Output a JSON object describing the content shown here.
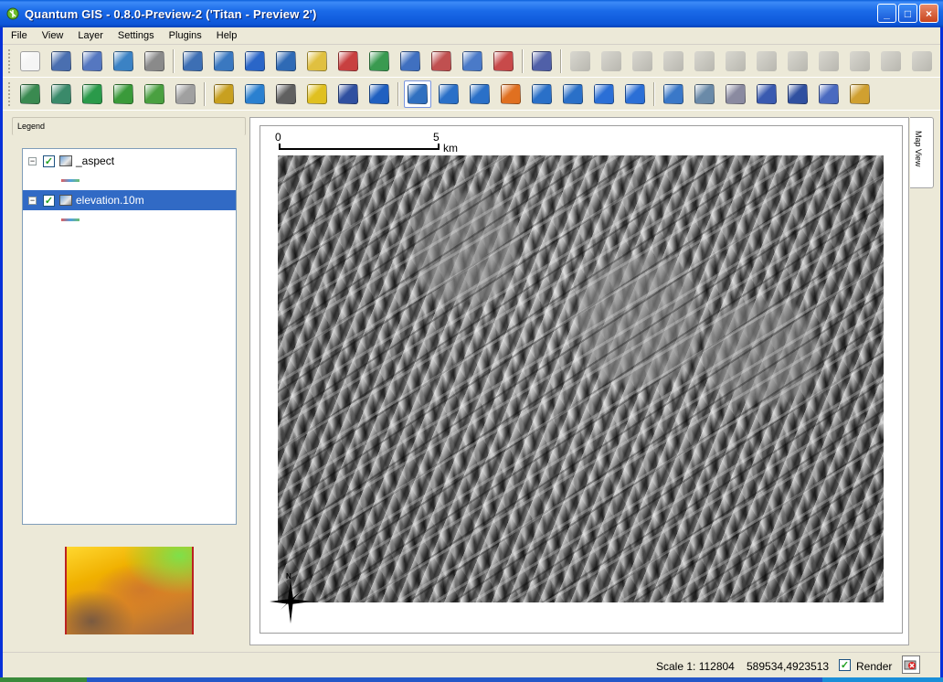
{
  "window": {
    "title": "Quantum GIS - 0.8.0-Preview-2 ('Titan - Preview 2')",
    "controls": {
      "minimize": "_",
      "maximize": "□",
      "close": "×"
    }
  },
  "menu": [
    "File",
    "View",
    "Layer",
    "Settings",
    "Plugins",
    "Help"
  ],
  "toolbar1": [
    {
      "name": "new-project-icon",
      "color": "#f5f5f5"
    },
    {
      "name": "save-project-icon",
      "color": "#4a6fb0"
    },
    {
      "name": "save-as-icon",
      "color": "#5577c0"
    },
    {
      "name": "open-project-icon",
      "color": "#3b82c4"
    },
    {
      "name": "print-icon",
      "color": "#8a8a8a"
    },
    {
      "name": "sep"
    },
    {
      "name": "map-composer-icon",
      "color": "#3d6fb4"
    },
    {
      "name": "export-map-icon",
      "color": "#3a78c0"
    },
    {
      "name": "add-database-layer-icon",
      "color": "#2a66c8"
    },
    {
      "name": "add-wms-layer-icon",
      "color": "#2f6ab5"
    },
    {
      "name": "add-vector-layer-icon",
      "color": "#e0c040"
    },
    {
      "name": "remove-layer-icon",
      "color": "#c84040"
    },
    {
      "name": "refresh-icon",
      "color": "#3a9a50"
    },
    {
      "name": "add-layer-to-overview-icon",
      "color": "#4070c0"
    },
    {
      "name": "remove-from-overview-icon",
      "color": "#c05050"
    },
    {
      "name": "show-all-layers-icon",
      "color": "#4a7ac8"
    },
    {
      "name": "hide-all-layers-icon",
      "color": "#c84a4a"
    },
    {
      "name": "sep"
    },
    {
      "name": "help-book-icon",
      "color": "#5060a8"
    },
    {
      "name": "sep"
    },
    {
      "name": "toggle-editing-icon",
      "color": "grey"
    },
    {
      "name": "capture-point-icon",
      "color": "grey"
    },
    {
      "name": "capture-line-icon",
      "color": "grey"
    },
    {
      "name": "capture-polygon-icon",
      "color": "grey"
    },
    {
      "name": "save-edits-icon",
      "color": "grey"
    },
    {
      "name": "add-ring-icon",
      "color": "grey"
    },
    {
      "name": "add-island-icon",
      "color": "grey"
    },
    {
      "name": "delete-selected-icon",
      "color": "grey"
    },
    {
      "name": "move-vertex-icon",
      "color": "grey"
    },
    {
      "name": "cut-features-icon",
      "color": "grey"
    },
    {
      "name": "copy-features-icon",
      "color": "grey"
    },
    {
      "name": "paste-features-icon",
      "color": "grey"
    }
  ],
  "toolbar2": [
    {
      "name": "plugin-manager-icon",
      "color": "#3a8a50"
    },
    {
      "name": "python-console-icon",
      "color": "#3a8a6a"
    },
    {
      "name": "tools-icon",
      "color": "#2a9a4a"
    },
    {
      "name": "digitize-icon",
      "color": "#3a9a3a"
    },
    {
      "name": "geometry-icon",
      "color": "#4aa040"
    },
    {
      "name": "vertex-icon",
      "color": "#a0a0a0"
    },
    {
      "name": "sep"
    },
    {
      "name": "measure-line-icon",
      "color": "#c8a020"
    },
    {
      "name": "globe-icon",
      "color": "#2a80d0"
    },
    {
      "name": "gps-icon",
      "color": "#606060"
    },
    {
      "name": "grid-icon",
      "color": "#e0c020"
    },
    {
      "name": "scalebar-icon",
      "color": "#3050a0"
    },
    {
      "name": "north-arrow-icon",
      "color": "#2060c0"
    },
    {
      "name": "sep"
    },
    {
      "name": "pan-hand-icon",
      "color": "#3070c0",
      "active": true
    },
    {
      "name": "zoom-in-icon",
      "color": "#2a70c8"
    },
    {
      "name": "zoom-out-icon",
      "color": "#2a70c8"
    },
    {
      "name": "zoom-full-icon",
      "color": "#e07020"
    },
    {
      "name": "zoom-to-selection-icon",
      "color": "#2a70c8"
    },
    {
      "name": "zoom-to-layer-icon",
      "color": "#2a70c8"
    },
    {
      "name": "zoom-last-icon",
      "color": "#2b6fd6"
    },
    {
      "name": "refresh-map-icon",
      "color": "#2b6fd6"
    },
    {
      "name": "sep"
    },
    {
      "name": "identify-icon",
      "color": "#3a78c8"
    },
    {
      "name": "select-features-icon",
      "color": "#6a8aa8"
    },
    {
      "name": "open-table-icon",
      "color": "#8a8aa0"
    },
    {
      "name": "measure-icon",
      "color": "#3a5ab0"
    },
    {
      "name": "measure-area-icon",
      "color": "#3050a0"
    },
    {
      "name": "map-tips-icon",
      "color": "#4a6ac0"
    },
    {
      "name": "new-bookmark-icon",
      "color": "#d0a030"
    }
  ],
  "legend": {
    "title": "Legend",
    "layers": [
      {
        "name": "_aspect",
        "checked": true,
        "selected": false
      },
      {
        "name": "elevation.10m",
        "checked": true,
        "selected": true
      }
    ]
  },
  "mapview": {
    "tab_label": "Map View",
    "scalebar": {
      "start": "0",
      "end": "5",
      "unit": "km"
    },
    "north_label": "N"
  },
  "status": {
    "scale": "Scale 1: 112804",
    "coordinates": "589534,4923513",
    "render_label": "Render",
    "render_checked": true
  }
}
